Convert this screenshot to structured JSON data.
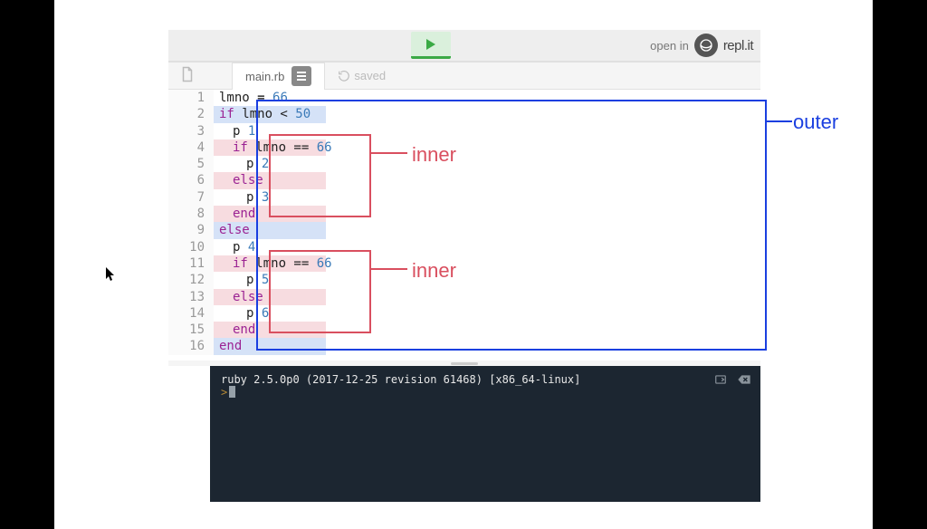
{
  "topbar": {
    "open_in": "open in",
    "brand": "repl.it"
  },
  "tabs": {
    "filename": "main.rb",
    "saved": "saved"
  },
  "line_numbers": [
    "1",
    "2",
    "3",
    "4",
    "5",
    "6",
    "7",
    "8",
    "9",
    "10",
    "11",
    "12",
    "13",
    "14",
    "15",
    "16"
  ],
  "code": {
    "l1_ident": "lmno ",
    "l1_eq": "= ",
    "l1_num": "66",
    "l2_kw": "if",
    "l2_rest": " lmno < ",
    "l2_num": "50",
    "l3_p": "p ",
    "l3_num": "1",
    "l4_kw": "if",
    "l4_rest": " lmno == ",
    "l4_num": "66",
    "l5_p": "p ",
    "l5_num": "2",
    "l6_kw": "else",
    "l7_p": "p ",
    "l7_num": "3",
    "l8_kw": "end",
    "l9_kw": "else",
    "l10_p": "p ",
    "l10_num": "4",
    "l11_kw": "if",
    "l11_rest": " lmno == ",
    "l11_num": "66",
    "l12_p": "p ",
    "l12_num": "5",
    "l13_kw": "else",
    "l14_p": "p ",
    "l14_num": "6",
    "l15_kw": "end",
    "l16_kw": "end"
  },
  "labels": {
    "inner": "inner",
    "outer": "outer"
  },
  "console": {
    "version": "ruby 2.5.0p0 (2017-12-25 revision 61468) [x86_64-linux]",
    "prompt": ">"
  }
}
